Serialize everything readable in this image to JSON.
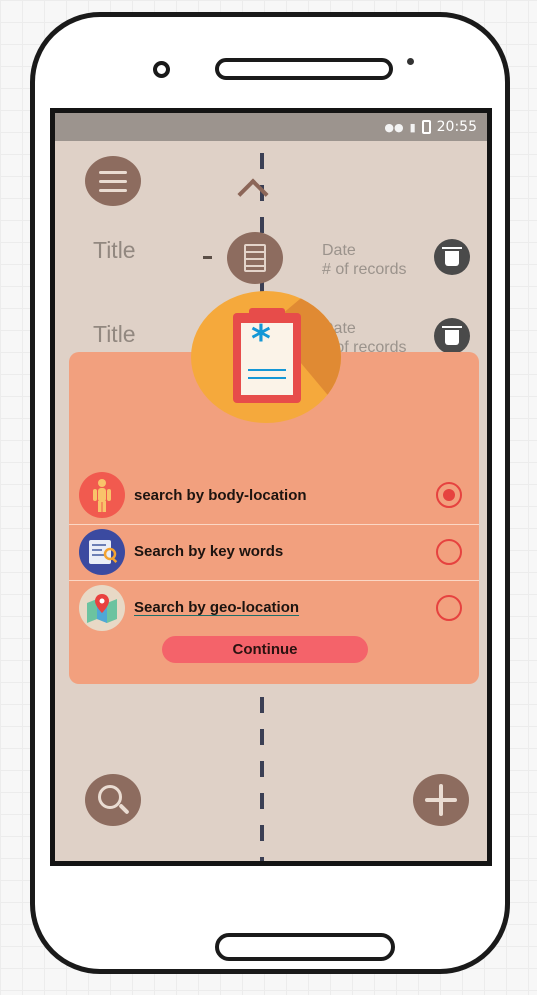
{
  "status_bar": {
    "time": "20:55",
    "wifi_icon": "wifi-icon",
    "signal_icon": "signal-icon",
    "battery_icon": "battery-icon"
  },
  "records": [
    {
      "title": "Title",
      "date_label": "Date",
      "count_label": "# of records"
    },
    {
      "title": "Title",
      "date_label": "Date",
      "count_label": "# of records"
    }
  ],
  "dialog": {
    "options": [
      {
        "label": "search by body-location",
        "icon": "body-figure-icon",
        "selected": true
      },
      {
        "label": "Search by key words",
        "icon": "keyword-search-icon",
        "selected": false
      },
      {
        "label": "Search by geo-location",
        "icon": "map-pin-icon",
        "selected": false
      }
    ],
    "continue_label": "Continue"
  },
  "colors": {
    "brown": "#8d6c5f",
    "screen_bg": "#dfd1c7",
    "dialog_bg": "#f2a07e",
    "accent_red": "#e6423f",
    "button": "#f4636a",
    "badge_orange": "#f5a93c"
  }
}
